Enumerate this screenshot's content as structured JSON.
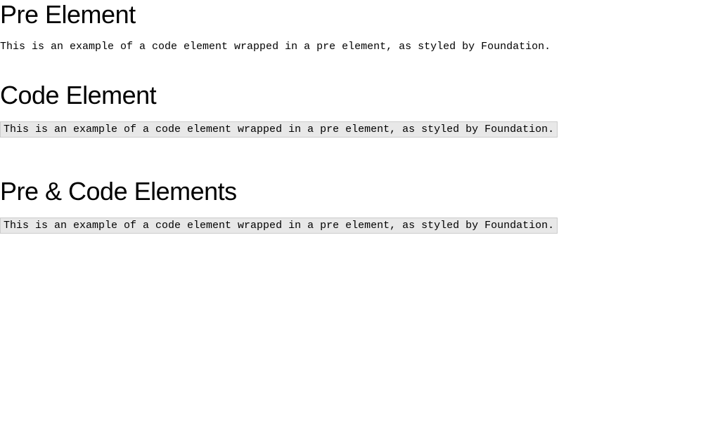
{
  "sections": {
    "pre": {
      "heading": "Pre Element",
      "content": "This is an example of a code element wrapped in a pre element, as styled by Foundation."
    },
    "code": {
      "heading": "Code Element",
      "content": "This is an example of a code element wrapped in a pre element, as styled by Foundation."
    },
    "precode": {
      "heading": "Pre & Code Elements",
      "content": "This is an example of a code element wrapped in a pre element, as styled by Foundation."
    }
  }
}
